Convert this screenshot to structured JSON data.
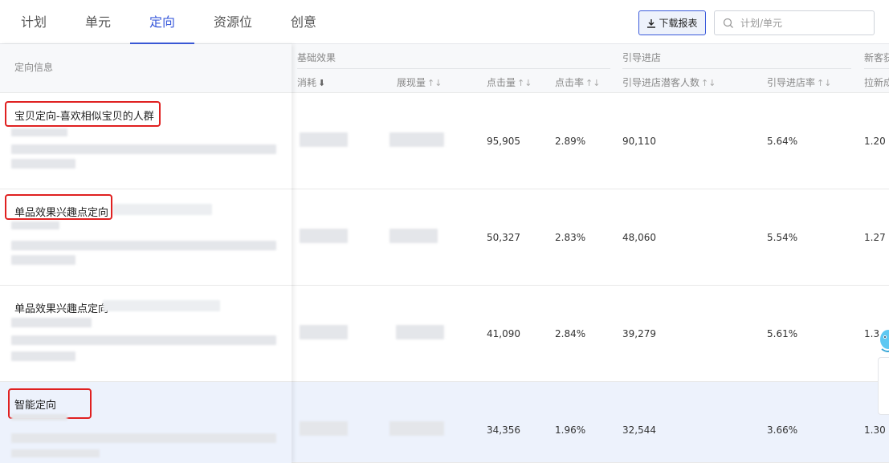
{
  "tabs": [
    {
      "label": "计划"
    },
    {
      "label": "单元"
    },
    {
      "label": "定向",
      "active": true
    },
    {
      "label": "资源位"
    },
    {
      "label": "创意"
    }
  ],
  "toolbar": {
    "download_label": "下载报表",
    "download_icon": "download-icon",
    "search_placeholder": "计划/单元",
    "search_icon": "search-icon"
  },
  "table": {
    "left_header": "定向信息",
    "groups": [
      {
        "label": "基础效果"
      },
      {
        "label": "引导进店"
      },
      {
        "label": "新客获"
      }
    ],
    "columns": [
      {
        "label": "消耗",
        "sort_icon": "⬇"
      },
      {
        "label": "展现量",
        "sort_icon": "↑↓"
      },
      {
        "label": "点击量",
        "sort_icon": "↑↓"
      },
      {
        "label": "点击率",
        "sort_icon": "↑↓"
      },
      {
        "label": "引导进店潜客人数",
        "sort_icon": "↑↓"
      },
      {
        "label": "引导进店率",
        "sort_icon": "↑↓"
      },
      {
        "label": "拉新成"
      }
    ],
    "rows": [
      {
        "name": "宝贝定向-喜欢相似宝贝的人群",
        "clicks": "95,905",
        "ctr": "2.89%",
        "visitors": "90,110",
        "visit_rate": "5.64%",
        "new": "1.20"
      },
      {
        "name": "单品效果兴趣点定向",
        "clicks": "50,327",
        "ctr": "2.83%",
        "visitors": "48,060",
        "visit_rate": "5.54%",
        "new": "1.27"
      },
      {
        "name": "单品效果兴趣点定向",
        "clicks": "41,090",
        "ctr": "2.84%",
        "visitors": "39,279",
        "visit_rate": "5.61%",
        "new": "1.3"
      },
      {
        "name": "智能定向",
        "clicks": "34,356",
        "ctr": "1.96%",
        "visitors": "32,544",
        "visit_rate": "3.66%",
        "new": "1.30"
      }
    ]
  },
  "colors": {
    "accent": "#3b5bdb",
    "annotation_red": "#e02020",
    "highlight_row": "#edf2fc"
  }
}
